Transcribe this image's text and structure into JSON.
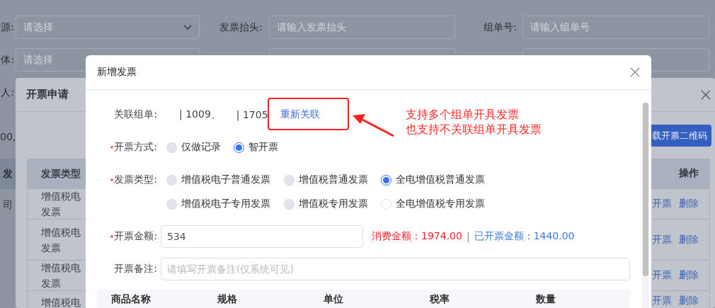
{
  "background": {
    "filter_rows": [
      [
        {
          "label": "源:",
          "kind": "select",
          "placeholder": "请选择"
        },
        {
          "label": "发票抬头:",
          "kind": "input",
          "placeholder": "请输入发票抬头"
        },
        {
          "label": "组单号:",
          "kind": "input",
          "placeholder": "请输入组单号"
        }
      ],
      [
        {
          "label": "体:",
          "kind": "input",
          "placeholder": "请选择"
        },
        {
          "kind": "input"
        },
        {
          "kind": "input"
        }
      ],
      [
        {
          "label": "人:"
        }
      ]
    ],
    "fragments": [
      {
        "kind": "text",
        "text": "00,"
      },
      {
        "kind": "header",
        "text": "发"
      },
      {
        "kind": "cell",
        "text": "司"
      }
    ]
  },
  "apply_dialog": {
    "title": "开票申请",
    "button": "载开票二维码",
    "table": {
      "columns": [
        "发票类型",
        "操作"
      ],
      "rows": [
        {
          "type_lines": [
            "增值税电",
            "发票"
          ],
          "actions": [
            "开票",
            "删除"
          ]
        },
        {
          "type_lines": [
            "增值税电",
            "发票"
          ],
          "actions": [
            "开票",
            "删除"
          ]
        },
        {
          "type_lines": [
            "增值税电",
            "发票"
          ],
          "actions": [
            "开票",
            "删除"
          ]
        },
        {
          "type_lines": [
            "增值税电"
          ],
          "actions": [
            "开票",
            "删除"
          ]
        }
      ]
    }
  },
  "invoice_dialog": {
    "title": "新增发票",
    "fields": [
      {
        "kind": "linked",
        "label": "关联组单:",
        "required": false,
        "values": [
          "| 1009、",
          "| 1705"
        ],
        "link": "重新关联"
      },
      {
        "kind": "radio",
        "label": "开票方式:",
        "required": true,
        "options": [
          {
            "label": "仅做记录",
            "selected": false,
            "disabled": true
          },
          {
            "label": "智开票",
            "selected": true,
            "disabled": false
          }
        ]
      },
      {
        "kind": "radio",
        "label": "发票类型:",
        "required": true,
        "options": [
          {
            "label": "增值税电子普通发票",
            "selected": false,
            "disabled": true
          },
          {
            "label": "增值税普通发票",
            "selected": false,
            "disabled": true
          },
          {
            "label": "全电增值税普通发票",
            "selected": true,
            "disabled": false
          },
          {
            "label": "增值税电子专用发票",
            "selected": false,
            "disabled": true
          },
          {
            "label": "增值税专用发票",
            "selected": false,
            "disabled": true
          },
          {
            "label": "全电增值税专用发票",
            "selected": false,
            "disabled": false
          }
        ]
      },
      {
        "kind": "amount",
        "label": "开票金额:",
        "required": true,
        "value": "534",
        "consumed": "消费金额：1974.00",
        "separator": "|",
        "issued": "已开票金额：1440.00"
      },
      {
        "kind": "text",
        "label": "开票备注:",
        "required": false,
        "placeholder": "请填写开票备注(仅系统可见)"
      }
    ],
    "items_table": {
      "columns": [
        "商品名称",
        "规格",
        "单位",
        "税率",
        "数量"
      ]
    }
  },
  "annotation": {
    "lines": [
      "支持多个组单开具发票",
      "也支持不关联组单开具发票"
    ]
  }
}
